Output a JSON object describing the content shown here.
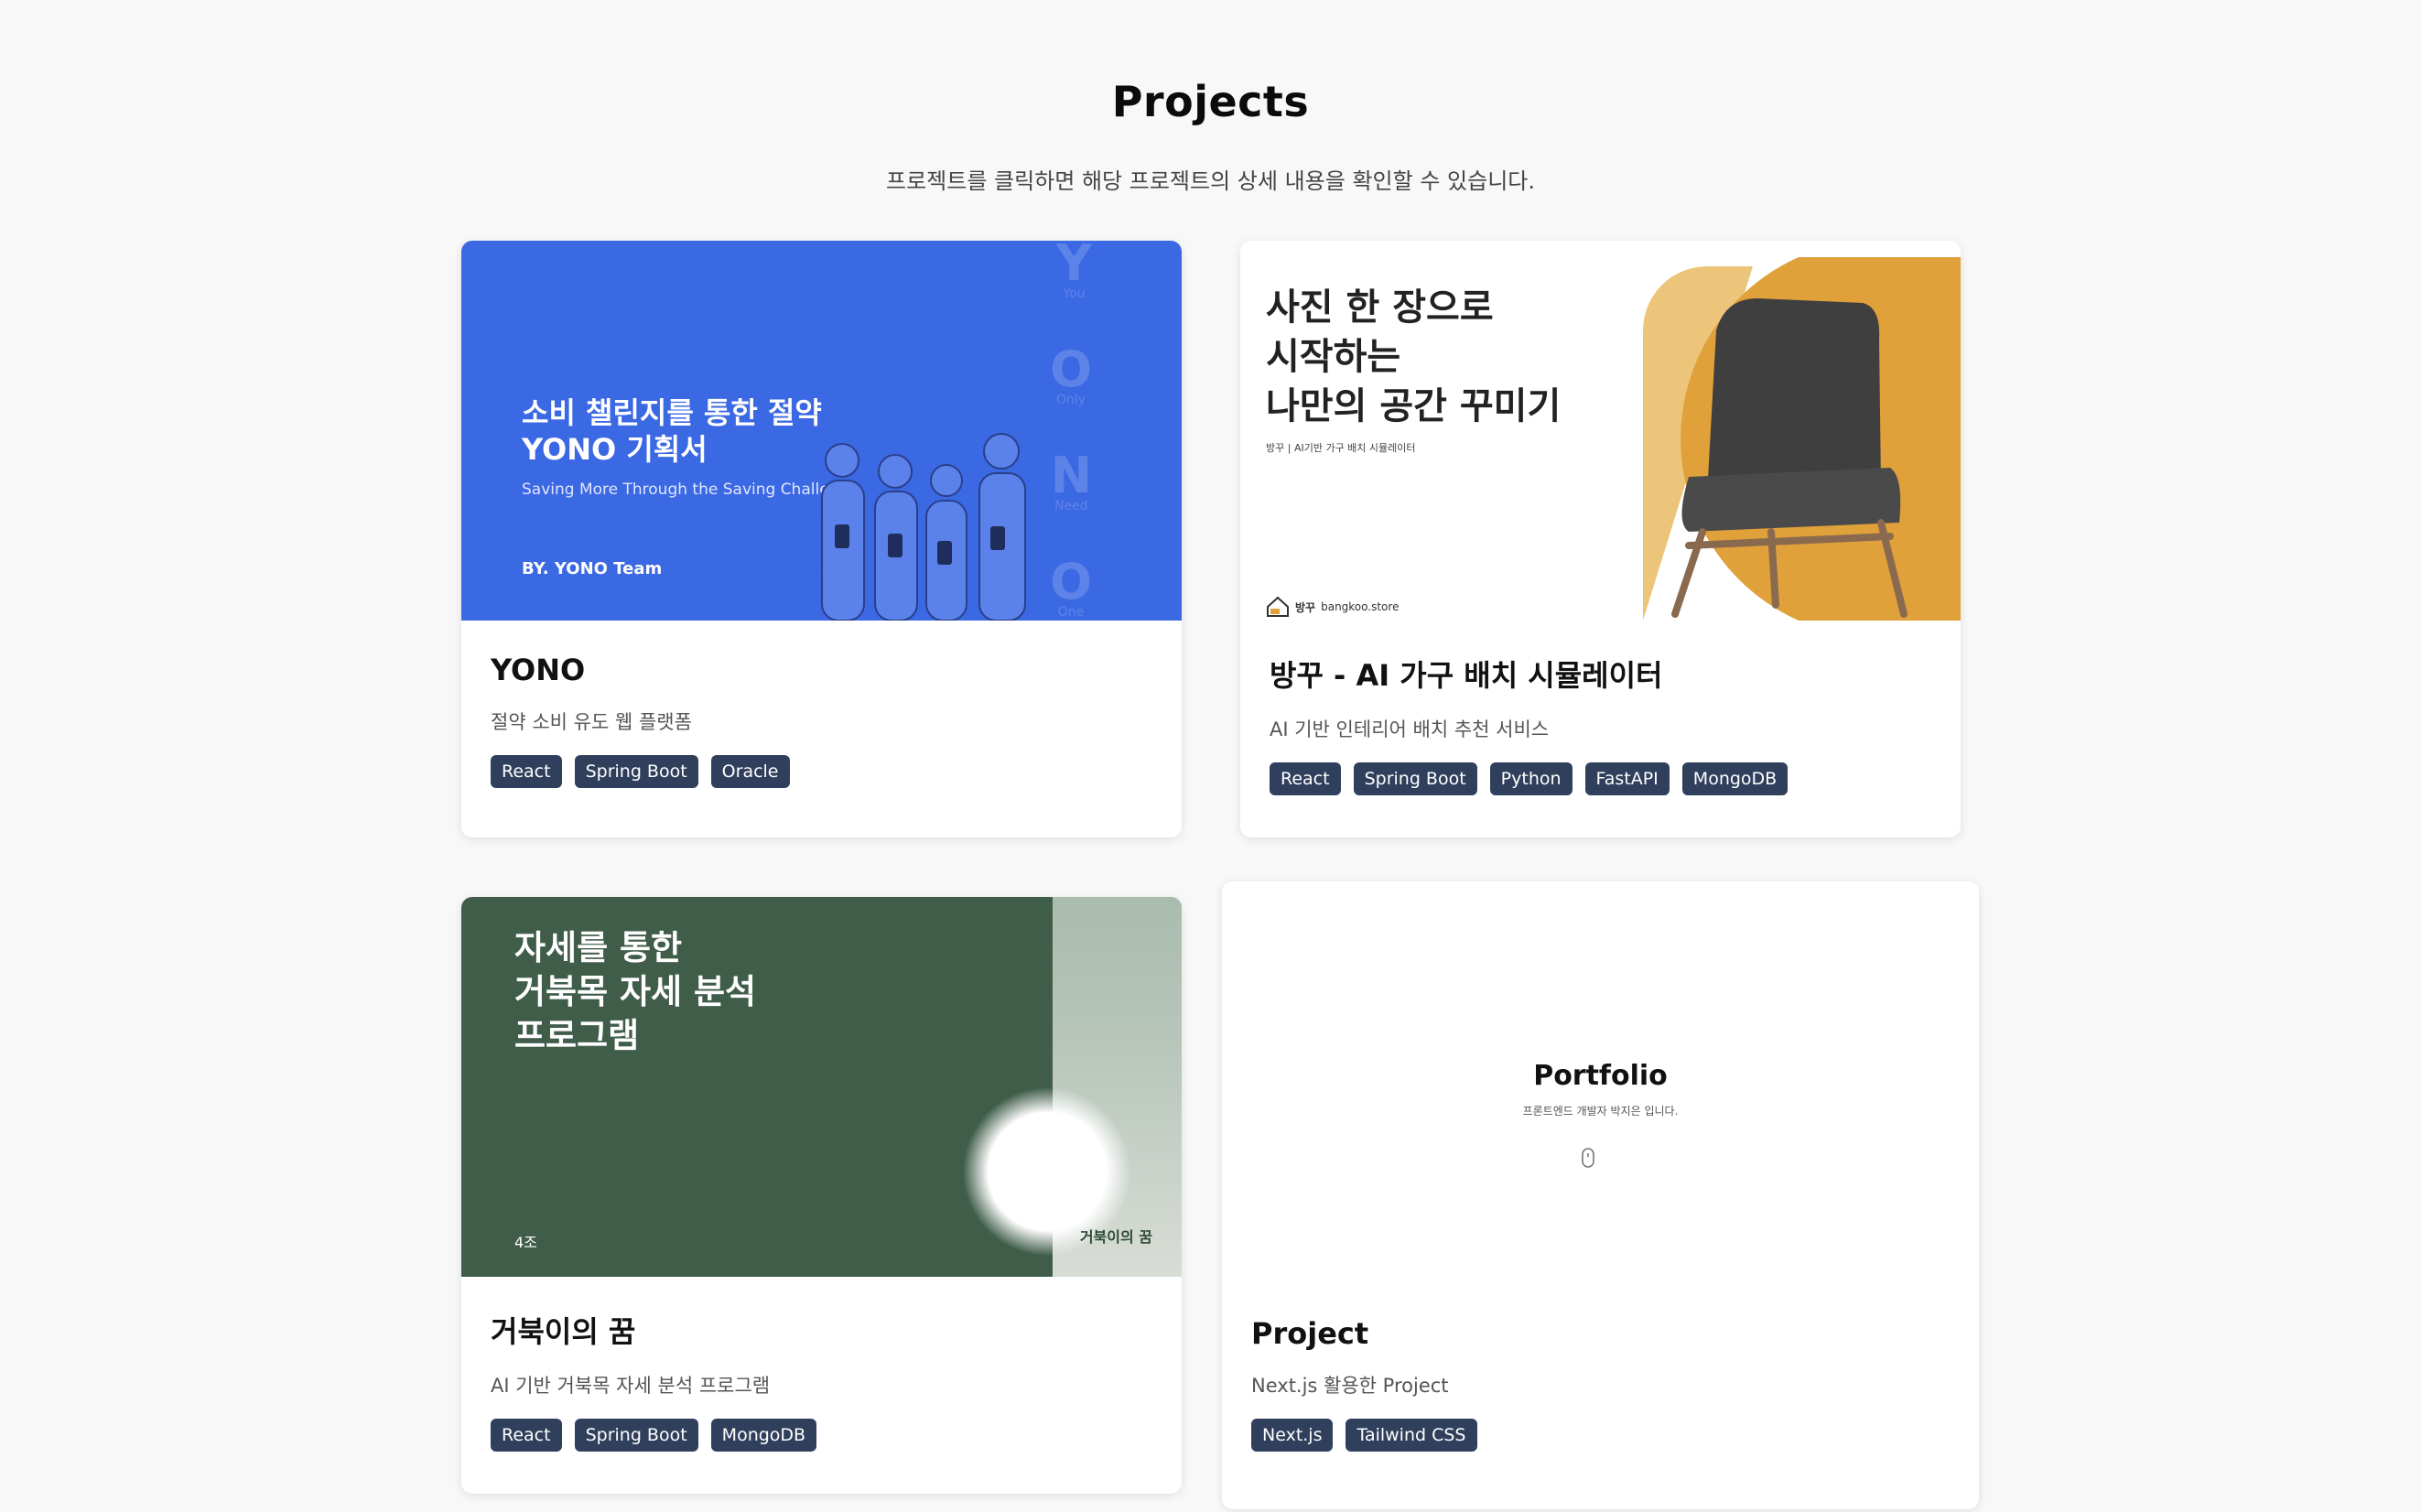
{
  "page": {
    "title": "Projects",
    "subtitle": "프로젝트를 클릭하면 해당 프로젝트의 상세 내용을 확인할 수 있습니다."
  },
  "projects": [
    {
      "title": "YONO",
      "description": "절약 소비 유도 웹 플랫폼",
      "tags": [
        "React",
        "Spring Boot",
        "Oracle"
      ],
      "thumbnail": {
        "heading_line1": "소비 챌린지를 통한 절약",
        "heading_line2": "YONO 기획서",
        "subtitle": "Saving More Through the Saving Challenge",
        "by": "BY. YONO Team",
        "letters": [
          {
            "letter": "Y",
            "word": "You"
          },
          {
            "letter": "O",
            "word": "Only"
          },
          {
            "letter": "N",
            "word": "Need"
          },
          {
            "letter": "O",
            "word": "One"
          }
        ]
      }
    },
    {
      "title": "방꾸 - AI 가구 배치 시뮬레이터",
      "description": "AI 기반 인테리어 배치 추천 서비스",
      "tags": [
        "React",
        "Spring Boot",
        "Python",
        "FastAPI",
        "MongoDB"
      ],
      "thumbnail": {
        "heading_line1": "사진 한 장으로",
        "heading_line2": "시작하는",
        "heading_line3": "나만의 공간 꾸미기",
        "small": "방꾸 | AI기반 가구 배치 시뮬레이터",
        "logo_text": "방꾸",
        "domain": "bangkoo.store"
      }
    },
    {
      "title": "거북이의 꿈",
      "description": "AI 기반 거북목 자세 분석 프로그램",
      "tags": [
        "React",
        "Spring Boot",
        "MongoDB"
      ],
      "thumbnail": {
        "heading_line1": "자세를 통한",
        "heading_line2": "거북목 자세 분석",
        "heading_line3": "프로그램",
        "team": "4조",
        "logo_text": "거북이의 꿈"
      }
    },
    {
      "title": "Project",
      "description": "Next.js 활용한 Project",
      "tags": [
        "Next.js",
        "Tailwind CSS"
      ],
      "thumbnail": {
        "title": "Portfolio",
        "subtitle": "프론트엔드 개발자 박지은 입니다."
      }
    }
  ],
  "colors": {
    "background": "#f8f8f8",
    "tag": "#2f3f5c",
    "yono_blue": "#3b68e3",
    "turtle_green": "#405d4a",
    "bangkoo_orange": "#e0a13a"
  }
}
